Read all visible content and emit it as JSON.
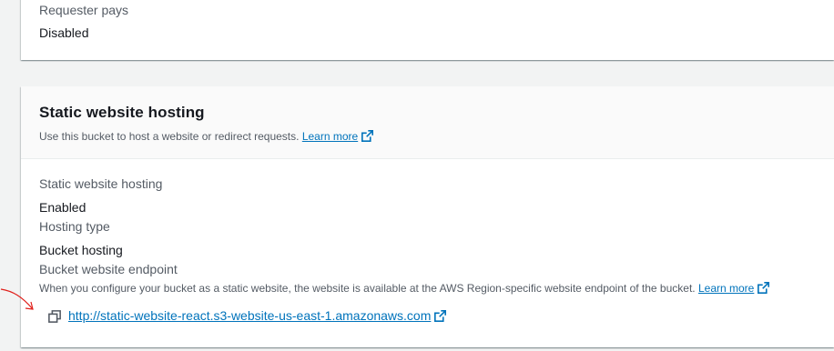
{
  "requester_pays": {
    "label": "Requester pays",
    "value": "Disabled"
  },
  "static_hosting": {
    "title": "Static website hosting",
    "description": "Use this bucket to host a website or redirect requests.",
    "learn_more": "Learn more",
    "hosting_label": "Static website hosting",
    "hosting_value": "Enabled",
    "type_label": "Hosting type",
    "type_value": "Bucket hosting",
    "endpoint_label": "Bucket website endpoint",
    "endpoint_description": "When you configure your bucket as a static website, the website is available at the AWS Region-specific website endpoint of the bucket.",
    "endpoint_learn_more": "Learn more",
    "endpoint_url": "http://static-website-react.s3-website-us-east-1.amazonaws.com"
  },
  "colors": {
    "link": "#0073bb",
    "annotation_arrow": "#e0201b"
  },
  "icons": {
    "external": "external-link-icon",
    "copy": "copy-icon",
    "arrow": "annotation-arrow-icon"
  }
}
